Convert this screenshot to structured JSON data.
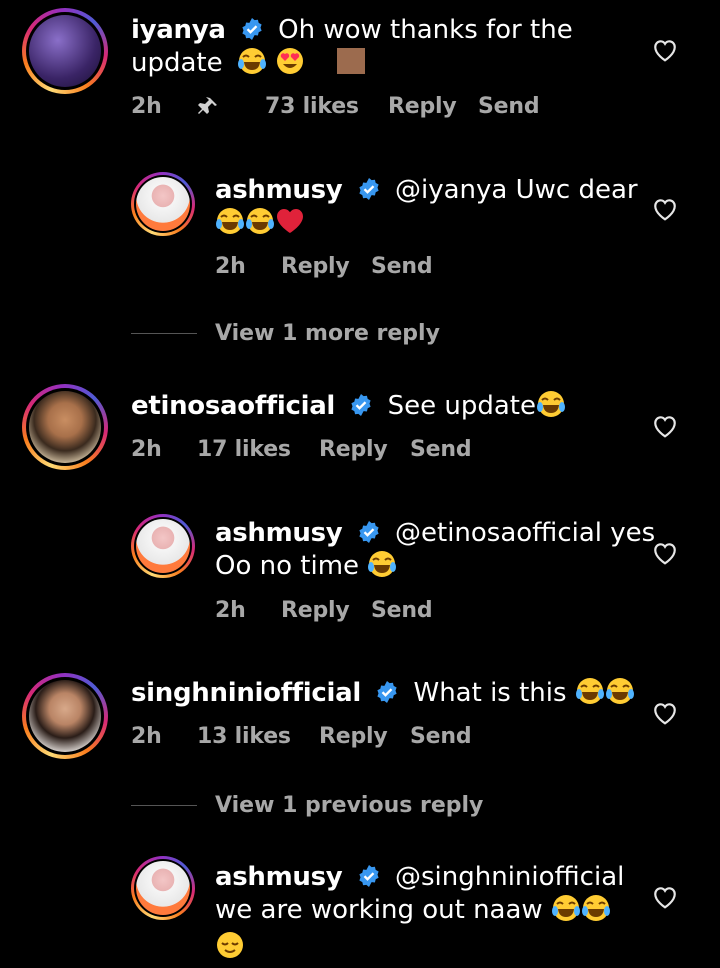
{
  "comments": [
    {
      "username": "iyanya",
      "text_line1": "Oh wow thanks for the",
      "text_line2": "update",
      "time": "2h",
      "likes": "73 likes",
      "reply": "Reply",
      "send": "Send"
    },
    {
      "username": "ashmusy",
      "text_line1": "@iyanya Uwc dear",
      "time": "2h",
      "reply": "Reply",
      "send": "Send"
    },
    {
      "username": "etinosaofficial",
      "text_line1": "See update",
      "time": "2h",
      "likes": "17 likes",
      "reply": "Reply",
      "send": "Send"
    },
    {
      "username": "ashmusy",
      "text_line1": "@etinosaofficial yes",
      "text_line2": "Oo no time",
      "time": "2h",
      "reply": "Reply",
      "send": "Send"
    },
    {
      "username": "singhniniofficial",
      "text_line1": "What is this",
      "time": "2h",
      "likes": "13 likes",
      "reply": "Reply",
      "send": "Send"
    },
    {
      "username": "ashmusy",
      "text_line1": "@singhniniofficial",
      "text_line2": "we are working out naaw"
    }
  ],
  "view_more_reply": "View 1 more reply",
  "view_previous_reply": "View 1 previous reply",
  "colors": {
    "verified": "#3897f0",
    "meta_text": "#a8a8a8",
    "background": "#000000"
  }
}
